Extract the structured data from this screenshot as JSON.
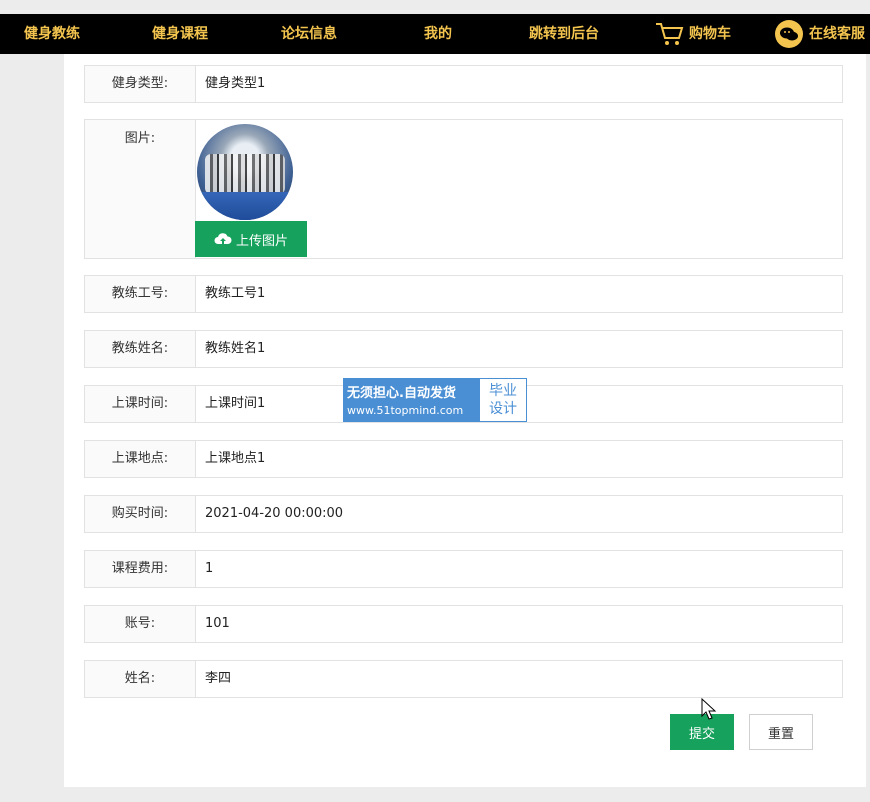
{
  "nav": {
    "items": [
      "健身教练",
      "健身课程",
      "论坛信息",
      "我的",
      "跳转到后台"
    ],
    "cart": "购物车",
    "service": "在线客服"
  },
  "form": {
    "fields": [
      {
        "label": "健身类型:",
        "value": "健身类型1"
      },
      {
        "label": "图片:"
      },
      {
        "label": "教练工号:",
        "value": "教练工号1"
      },
      {
        "label": "教练姓名:",
        "value": "教练姓名1"
      },
      {
        "label": "上课时间:",
        "value": "上课时间1"
      },
      {
        "label": "上课地点:",
        "value": "上课地点1"
      },
      {
        "label": "购买时间:",
        "value": "2021-04-20 00:00:00"
      },
      {
        "label": "课程费用:",
        "value": "1"
      },
      {
        "label": "账号:",
        "value": "101"
      },
      {
        "label": "姓名:",
        "value": "李四"
      }
    ],
    "upload_label": "上传图片",
    "submit_label": "提交",
    "reset_label": "重置"
  },
  "watermark": {
    "line1": "无须担心.自动发货",
    "line2": "www.51topmind.com",
    "right1": "毕业",
    "right2": "设计"
  },
  "colors": {
    "nav_bg": "#000000",
    "nav_text": "#f3c44e",
    "primary_green": "#16a15c",
    "watermark_blue": "#4a8fd4"
  }
}
